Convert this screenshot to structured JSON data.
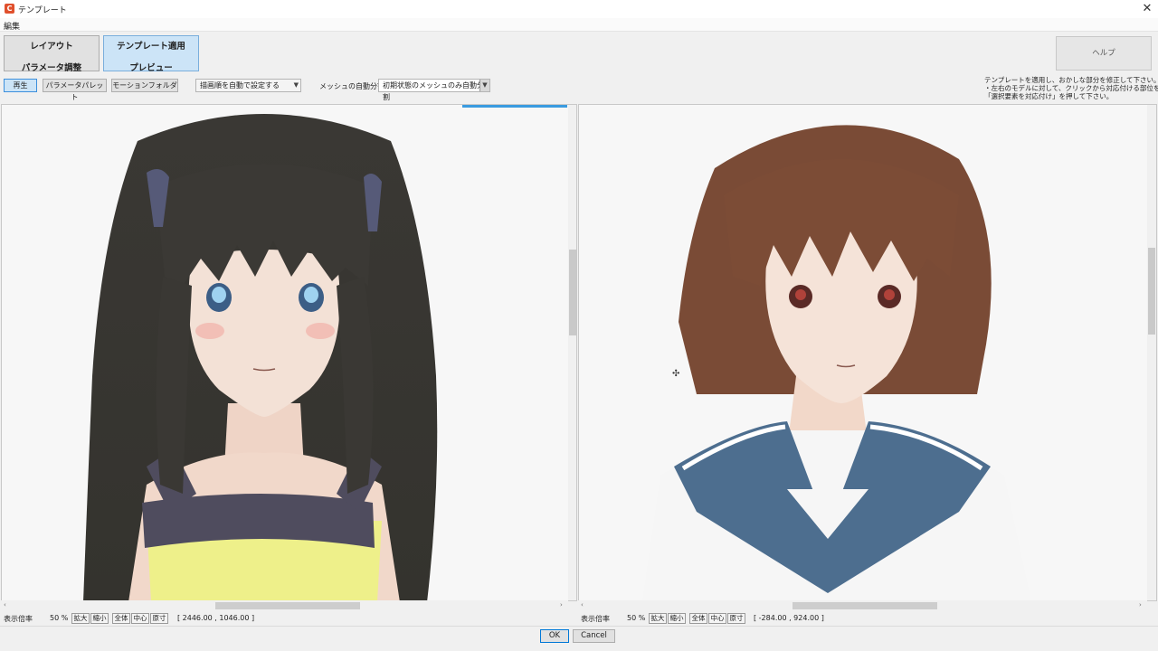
{
  "window": {
    "title": "テンプレート",
    "close_glyph": "✕",
    "app_icon": "cubism-logo-icon"
  },
  "menu": {
    "edit": "編集"
  },
  "modes": {
    "layout": "レイアウト",
    "param_adjust": "パラメータ調整",
    "template_apply": "テンプレート適用",
    "preview": "プレビュー"
  },
  "help": "ヘルプ",
  "toolbar": {
    "play": "再生",
    "param_palette": "パラメータパレット",
    "motion_folder": "モーションフォルダ",
    "draw_order": "描画順を自動で設定する",
    "mesh_label": "メッシュの自動分割",
    "mesh_value": "初期状態のメッシュのみ自動分割"
  },
  "instructions": [
    "テンプレートを適用し、おかしな部分を修正して下さい。",
    "・左右のモデルに対して、クリックから対応付ける部位を選び、",
    "「選択要素を対応付け」を押して下さい。"
  ],
  "status_left": {
    "zoom_label": "表示倍率",
    "zoom_value": "50 %",
    "btn_zoom_in": "拡大",
    "btn_zoom_out": "縮小",
    "btn_all": "全体",
    "btn_center": "中心",
    "btn_actual": "原寸",
    "coords": "[ 2446.00 , 1046.00 ]"
  },
  "status_right": {
    "zoom_label": "表示倍率",
    "zoom_value": "50 %",
    "btn_zoom_in": "拡大",
    "btn_zoom_out": "縮小",
    "btn_all": "全体",
    "btn_center": "中心",
    "btn_actual": "原寸",
    "coords": "[ -284.00 , 924.00 ]"
  },
  "dialog": {
    "ok": "OK",
    "cancel": "Cancel"
  },
  "colors": {
    "accent": "#0078d7",
    "active_mode": "#cce4f7",
    "hair_left": "#3e3a36",
    "hair_right": "#7a4b36",
    "collar": "#4d6e8f"
  }
}
